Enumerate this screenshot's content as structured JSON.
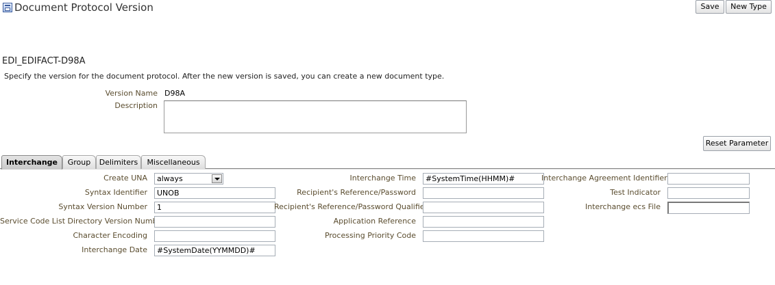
{
  "header": {
    "title": "Document Protocol Version",
    "icon": "document-protocol-icon",
    "save_label": "Save",
    "new_type_label": "New Type"
  },
  "protocol": {
    "name": "EDI_EDIFACT-D98A",
    "instructions": "Specify the version for the document protocol. After the new version is saved, you can create a new document type."
  },
  "form": {
    "version_name_label": "Version Name",
    "version_name_value": "D98A",
    "description_label": "Description",
    "description_value": ""
  },
  "reset_label": "Reset Parameter",
  "tabs": [
    {
      "label": "Interchange",
      "active": true
    },
    {
      "label": "Group",
      "active": false
    },
    {
      "label": "Delimiters",
      "active": false
    },
    {
      "label": "Miscellaneous",
      "active": false
    }
  ],
  "interchange": {
    "col1": [
      {
        "label": "Create UNA",
        "value": "always",
        "type": "select"
      },
      {
        "label": "Syntax Identifier",
        "value": "UNOB",
        "type": "text"
      },
      {
        "label": "Syntax Version Number",
        "value": "1",
        "type": "text"
      },
      {
        "label": "Service Code List Directory Version Number",
        "value": "",
        "type": "text"
      },
      {
        "label": "Character Encoding",
        "value": "",
        "type": "text"
      },
      {
        "label": "Interchange Date",
        "value": "#SystemDate(YYMMDD)#",
        "type": "text"
      }
    ],
    "col2": [
      {
        "label": "Interchange Time",
        "value": "#SystemTime(HHMM)#",
        "type": "text"
      },
      {
        "label": "Recipient's Reference/Password",
        "value": "",
        "type": "text"
      },
      {
        "label": "Recipient's Reference/Password Qualifier",
        "value": "",
        "type": "text"
      },
      {
        "label": "Application Reference",
        "value": "",
        "type": "text"
      },
      {
        "label": "Processing Priority Code",
        "value": "",
        "type": "text"
      }
    ],
    "col3": [
      {
        "label": "Interchange Agreement Identifier",
        "value": "",
        "type": "text"
      },
      {
        "label": "Test Indicator",
        "value": "",
        "type": "text"
      },
      {
        "label": "Interchange ecs File",
        "value": "",
        "type": "file"
      }
    ]
  }
}
